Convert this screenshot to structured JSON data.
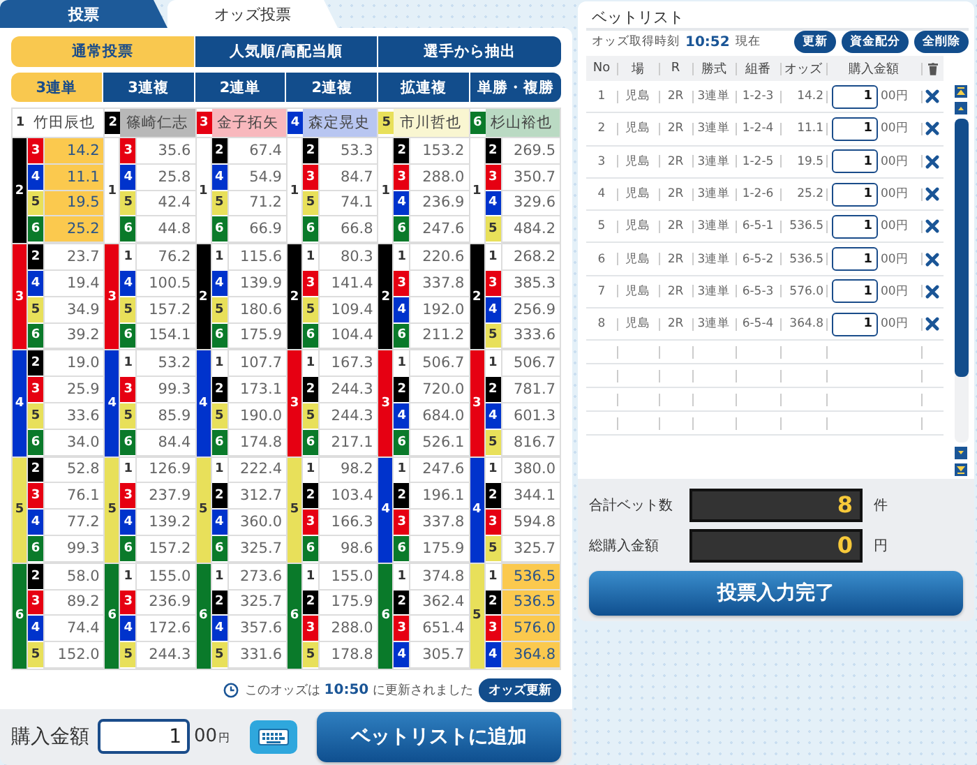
{
  "tabs": [
    {
      "label": "投票",
      "selected": false
    },
    {
      "label": "オッズ投票",
      "selected": true
    }
  ],
  "modes": [
    {
      "label": "通常投票",
      "selected": true
    },
    {
      "label": "人気順/高配当順",
      "selected": false
    },
    {
      "label": "選手から抽出",
      "selected": false
    }
  ],
  "bet_types": [
    {
      "label": "3連単",
      "selected": true
    },
    {
      "label": "3連複",
      "selected": false
    },
    {
      "label": "2連単",
      "selected": false
    },
    {
      "label": "2連複",
      "selected": false
    },
    {
      "label": "拡連複",
      "selected": false
    },
    {
      "label": "単勝・複勝",
      "selected": false
    }
  ],
  "racers": [
    {
      "number": "1",
      "name": "竹田辰也",
      "color": "#ffffff"
    },
    {
      "number": "2",
      "name": "篠崎仁志",
      "color": "#000000"
    },
    {
      "number": "3",
      "name": "金子拓矢",
      "color": "#e60012"
    },
    {
      "number": "4",
      "name": "森定晃史",
      "color": "#0033cc"
    },
    {
      "number": "5",
      "name": "市川哲也",
      "color": "#e8e05a"
    },
    {
      "number": "6",
      "name": "杉山裕也",
      "color": "#0a7a2a"
    }
  ],
  "odds_columns": [
    {
      "blocks": [
        {
          "boat": "2",
          "color": "#000000",
          "rows": [
            {
              "boat": "3",
              "color": "#e60012",
              "odds": "14.2",
              "selected": true
            },
            {
              "boat": "4",
              "color": "#0033cc",
              "odds": "11.1",
              "selected": true
            },
            {
              "boat": "5",
              "color": "#e8e05a",
              "odds": "19.5",
              "selected": true
            },
            {
              "boat": "6",
              "color": "#0a7a2a",
              "odds": "25.2",
              "selected": true
            }
          ]
        },
        {
          "boat": "3",
          "color": "#e60012",
          "rows": [
            {
              "boat": "2",
              "color": "#000000",
              "odds": "23.7",
              "selected": false
            },
            {
              "boat": "4",
              "color": "#0033cc",
              "odds": "19.4",
              "selected": false
            },
            {
              "boat": "5",
              "color": "#e8e05a",
              "odds": "34.9",
              "selected": false
            },
            {
              "boat": "6",
              "color": "#0a7a2a",
              "odds": "39.2",
              "selected": false
            }
          ]
        },
        {
          "boat": "4",
          "color": "#0033cc",
          "rows": [
            {
              "boat": "2",
              "color": "#000000",
              "odds": "19.0",
              "selected": false
            },
            {
              "boat": "3",
              "color": "#e60012",
              "odds": "25.9",
              "selected": false
            },
            {
              "boat": "5",
              "color": "#e8e05a",
              "odds": "33.6",
              "selected": false
            },
            {
              "boat": "6",
              "color": "#0a7a2a",
              "odds": "34.0",
              "selected": false
            }
          ]
        },
        {
          "boat": "5",
          "color": "#e8e05a",
          "rows": [
            {
              "boat": "2",
              "color": "#000000",
              "odds": "52.8",
              "selected": false
            },
            {
              "boat": "3",
              "color": "#e60012",
              "odds": "76.1",
              "selected": false
            },
            {
              "boat": "4",
              "color": "#0033cc",
              "odds": "77.2",
              "selected": false
            },
            {
              "boat": "6",
              "color": "#0a7a2a",
              "odds": "99.3",
              "selected": false
            }
          ]
        },
        {
          "boat": "6",
          "color": "#0a7a2a",
          "rows": [
            {
              "boat": "2",
              "color": "#000000",
              "odds": "58.0",
              "selected": false
            },
            {
              "boat": "3",
              "color": "#e60012",
              "odds": "89.2",
              "selected": false
            },
            {
              "boat": "4",
              "color": "#0033cc",
              "odds": "74.4",
              "selected": false
            },
            {
              "boat": "5",
              "color": "#e8e05a",
              "odds": "152.0",
              "selected": false
            }
          ]
        }
      ]
    },
    {
      "blocks": [
        {
          "boat": "1",
          "color": "#ffffff",
          "rows": [
            {
              "boat": "3",
              "color": "#e60012",
              "odds": "35.6",
              "selected": false
            },
            {
              "boat": "4",
              "color": "#0033cc",
              "odds": "25.8",
              "selected": false
            },
            {
              "boat": "5",
              "color": "#e8e05a",
              "odds": "42.4",
              "selected": false
            },
            {
              "boat": "6",
              "color": "#0a7a2a",
              "odds": "44.8",
              "selected": false
            }
          ]
        },
        {
          "boat": "3",
          "color": "#e60012",
          "rows": [
            {
              "boat": "1",
              "color": "#ffffff",
              "odds": "76.2",
              "selected": false
            },
            {
              "boat": "4",
              "color": "#0033cc",
              "odds": "100.5",
              "selected": false
            },
            {
              "boat": "5",
              "color": "#e8e05a",
              "odds": "157.2",
              "selected": false
            },
            {
              "boat": "6",
              "color": "#0a7a2a",
              "odds": "154.1",
              "selected": false
            }
          ]
        },
        {
          "boat": "4",
          "color": "#0033cc",
          "rows": [
            {
              "boat": "1",
              "color": "#ffffff",
              "odds": "53.2",
              "selected": false
            },
            {
              "boat": "3",
              "color": "#e60012",
              "odds": "99.3",
              "selected": false
            },
            {
              "boat": "5",
              "color": "#e8e05a",
              "odds": "85.9",
              "selected": false
            },
            {
              "boat": "6",
              "color": "#0a7a2a",
              "odds": "84.4",
              "selected": false
            }
          ]
        },
        {
          "boat": "5",
          "color": "#e8e05a",
          "rows": [
            {
              "boat": "1",
              "color": "#ffffff",
              "odds": "126.9",
              "selected": false
            },
            {
              "boat": "3",
              "color": "#e60012",
              "odds": "237.9",
              "selected": false
            },
            {
              "boat": "4",
              "color": "#0033cc",
              "odds": "139.2",
              "selected": false
            },
            {
              "boat": "6",
              "color": "#0a7a2a",
              "odds": "157.2",
              "selected": false
            }
          ]
        },
        {
          "boat": "6",
          "color": "#0a7a2a",
          "rows": [
            {
              "boat": "1",
              "color": "#ffffff",
              "odds": "155.0",
              "selected": false
            },
            {
              "boat": "3",
              "color": "#e60012",
              "odds": "236.9",
              "selected": false
            },
            {
              "boat": "4",
              "color": "#0033cc",
              "odds": "172.6",
              "selected": false
            },
            {
              "boat": "5",
              "color": "#e8e05a",
              "odds": "244.3",
              "selected": false
            }
          ]
        }
      ]
    },
    {
      "blocks": [
        {
          "boat": "1",
          "color": "#ffffff",
          "rows": [
            {
              "boat": "2",
              "color": "#000000",
              "odds": "67.4",
              "selected": false
            },
            {
              "boat": "4",
              "color": "#0033cc",
              "odds": "54.9",
              "selected": false
            },
            {
              "boat": "5",
              "color": "#e8e05a",
              "odds": "71.2",
              "selected": false
            },
            {
              "boat": "6",
              "color": "#0a7a2a",
              "odds": "66.9",
              "selected": false
            }
          ]
        },
        {
          "boat": "2",
          "color": "#000000",
          "rows": [
            {
              "boat": "1",
              "color": "#ffffff",
              "odds": "115.6",
              "selected": false
            },
            {
              "boat": "4",
              "color": "#0033cc",
              "odds": "139.9",
              "selected": false
            },
            {
              "boat": "5",
              "color": "#e8e05a",
              "odds": "180.6",
              "selected": false
            },
            {
              "boat": "6",
              "color": "#0a7a2a",
              "odds": "175.9",
              "selected": false
            }
          ]
        },
        {
          "boat": "4",
          "color": "#0033cc",
          "rows": [
            {
              "boat": "1",
              "color": "#ffffff",
              "odds": "107.7",
              "selected": false
            },
            {
              "boat": "2",
              "color": "#000000",
              "odds": "173.1",
              "selected": false
            },
            {
              "boat": "5",
              "color": "#e8e05a",
              "odds": "190.0",
              "selected": false
            },
            {
              "boat": "6",
              "color": "#0a7a2a",
              "odds": "174.8",
              "selected": false
            }
          ]
        },
        {
          "boat": "5",
          "color": "#e8e05a",
          "rows": [
            {
              "boat": "1",
              "color": "#ffffff",
              "odds": "222.4",
              "selected": false
            },
            {
              "boat": "2",
              "color": "#000000",
              "odds": "312.7",
              "selected": false
            },
            {
              "boat": "4",
              "color": "#0033cc",
              "odds": "360.0",
              "selected": false
            },
            {
              "boat": "6",
              "color": "#0a7a2a",
              "odds": "325.7",
              "selected": false
            }
          ]
        },
        {
          "boat": "6",
          "color": "#0a7a2a",
          "rows": [
            {
              "boat": "1",
              "color": "#ffffff",
              "odds": "273.6",
              "selected": false
            },
            {
              "boat": "2",
              "color": "#000000",
              "odds": "325.7",
              "selected": false
            },
            {
              "boat": "4",
              "color": "#0033cc",
              "odds": "357.6",
              "selected": false
            },
            {
              "boat": "5",
              "color": "#e8e05a",
              "odds": "331.6",
              "selected": false
            }
          ]
        }
      ]
    },
    {
      "blocks": [
        {
          "boat": "1",
          "color": "#ffffff",
          "rows": [
            {
              "boat": "2",
              "color": "#000000",
              "odds": "53.3",
              "selected": false
            },
            {
              "boat": "3",
              "color": "#e60012",
              "odds": "84.7",
              "selected": false
            },
            {
              "boat": "5",
              "color": "#e8e05a",
              "odds": "74.1",
              "selected": false
            },
            {
              "boat": "6",
              "color": "#0a7a2a",
              "odds": "66.8",
              "selected": false
            }
          ]
        },
        {
          "boat": "2",
          "color": "#000000",
          "rows": [
            {
              "boat": "1",
              "color": "#ffffff",
              "odds": "80.3",
              "selected": false
            },
            {
              "boat": "3",
              "color": "#e60012",
              "odds": "141.4",
              "selected": false
            },
            {
              "boat": "5",
              "color": "#e8e05a",
              "odds": "109.4",
              "selected": false
            },
            {
              "boat": "6",
              "color": "#0a7a2a",
              "odds": "104.4",
              "selected": false
            }
          ]
        },
        {
          "boat": "3",
          "color": "#e60012",
          "rows": [
            {
              "boat": "1",
              "color": "#ffffff",
              "odds": "167.3",
              "selected": false
            },
            {
              "boat": "2",
              "color": "#000000",
              "odds": "244.3",
              "selected": false
            },
            {
              "boat": "5",
              "color": "#e8e05a",
              "odds": "244.3",
              "selected": false
            },
            {
              "boat": "6",
              "color": "#0a7a2a",
              "odds": "217.1",
              "selected": false
            }
          ]
        },
        {
          "boat": "5",
          "color": "#e8e05a",
          "rows": [
            {
              "boat": "1",
              "color": "#ffffff",
              "odds": "98.2",
              "selected": false
            },
            {
              "boat": "2",
              "color": "#000000",
              "odds": "103.4",
              "selected": false
            },
            {
              "boat": "3",
              "color": "#e60012",
              "odds": "166.3",
              "selected": false
            },
            {
              "boat": "6",
              "color": "#0a7a2a",
              "odds": "98.6",
              "selected": false
            }
          ]
        },
        {
          "boat": "6",
          "color": "#0a7a2a",
          "rows": [
            {
              "boat": "1",
              "color": "#ffffff",
              "odds": "155.0",
              "selected": false
            },
            {
              "boat": "2",
              "color": "#000000",
              "odds": "175.9",
              "selected": false
            },
            {
              "boat": "3",
              "color": "#e60012",
              "odds": "288.0",
              "selected": false
            },
            {
              "boat": "5",
              "color": "#e8e05a",
              "odds": "178.8",
              "selected": false
            }
          ]
        }
      ]
    },
    {
      "blocks": [
        {
          "boat": "1",
          "color": "#ffffff",
          "rows": [
            {
              "boat": "2",
              "color": "#000000",
              "odds": "153.2",
              "selected": false
            },
            {
              "boat": "3",
              "color": "#e60012",
              "odds": "288.0",
              "selected": false
            },
            {
              "boat": "4",
              "color": "#0033cc",
              "odds": "236.9",
              "selected": false
            },
            {
              "boat": "6",
              "color": "#0a7a2a",
              "odds": "247.6",
              "selected": false
            }
          ]
        },
        {
          "boat": "2",
          "color": "#000000",
          "rows": [
            {
              "boat": "1",
              "color": "#ffffff",
              "odds": "220.6",
              "selected": false
            },
            {
              "boat": "3",
              "color": "#e60012",
              "odds": "337.8",
              "selected": false
            },
            {
              "boat": "4",
              "color": "#0033cc",
              "odds": "192.0",
              "selected": false
            },
            {
              "boat": "6",
              "color": "#0a7a2a",
              "odds": "211.2",
              "selected": false
            }
          ]
        },
        {
          "boat": "3",
          "color": "#e60012",
          "rows": [
            {
              "boat": "1",
              "color": "#ffffff",
              "odds": "506.7",
              "selected": false
            },
            {
              "boat": "2",
              "color": "#000000",
              "odds": "720.0",
              "selected": false
            },
            {
              "boat": "4",
              "color": "#0033cc",
              "odds": "684.0",
              "selected": false
            },
            {
              "boat": "6",
              "color": "#0a7a2a",
              "odds": "526.1",
              "selected": false
            }
          ]
        },
        {
          "boat": "4",
          "color": "#0033cc",
          "rows": [
            {
              "boat": "1",
              "color": "#ffffff",
              "odds": "247.6",
              "selected": false
            },
            {
              "boat": "2",
              "color": "#000000",
              "odds": "196.1",
              "selected": false
            },
            {
              "boat": "3",
              "color": "#e60012",
              "odds": "337.8",
              "selected": false
            },
            {
              "boat": "6",
              "color": "#0a7a2a",
              "odds": "175.9",
              "selected": false
            }
          ]
        },
        {
          "boat": "6",
          "color": "#0a7a2a",
          "rows": [
            {
              "boat": "1",
              "color": "#ffffff",
              "odds": "374.8",
              "selected": false
            },
            {
              "boat": "2",
              "color": "#000000",
              "odds": "362.4",
              "selected": false
            },
            {
              "boat": "3",
              "color": "#e60012",
              "odds": "651.4",
              "selected": false
            },
            {
              "boat": "4",
              "color": "#0033cc",
              "odds": "305.7",
              "selected": false
            }
          ]
        }
      ]
    },
    {
      "blocks": [
        {
          "boat": "1",
          "color": "#ffffff",
          "rows": [
            {
              "boat": "2",
              "color": "#000000",
              "odds": "269.5",
              "selected": false
            },
            {
              "boat": "3",
              "color": "#e60012",
              "odds": "350.7",
              "selected": false
            },
            {
              "boat": "4",
              "color": "#0033cc",
              "odds": "329.6",
              "selected": false
            },
            {
              "boat": "5",
              "color": "#e8e05a",
              "odds": "484.2",
              "selected": false
            }
          ]
        },
        {
          "boat": "2",
          "color": "#000000",
          "rows": [
            {
              "boat": "1",
              "color": "#ffffff",
              "odds": "268.2",
              "selected": false
            },
            {
              "boat": "3",
              "color": "#e60012",
              "odds": "385.3",
              "selected": false
            },
            {
              "boat": "4",
              "color": "#0033cc",
              "odds": "256.9",
              "selected": false
            },
            {
              "boat": "5",
              "color": "#e8e05a",
              "odds": "333.6",
              "selected": false
            }
          ]
        },
        {
          "boat": "3",
          "color": "#e60012",
          "rows": [
            {
              "boat": "1",
              "color": "#ffffff",
              "odds": "506.7",
              "selected": false
            },
            {
              "boat": "2",
              "color": "#000000",
              "odds": "781.7",
              "selected": false
            },
            {
              "boat": "4",
              "color": "#0033cc",
              "odds": "601.3",
              "selected": false
            },
            {
              "boat": "5",
              "color": "#e8e05a",
              "odds": "816.7",
              "selected": false
            }
          ]
        },
        {
          "boat": "4",
          "color": "#0033cc",
          "rows": [
            {
              "boat": "1",
              "color": "#ffffff",
              "odds": "380.0",
              "selected": false
            },
            {
              "boat": "2",
              "color": "#000000",
              "odds": "344.1",
              "selected": false
            },
            {
              "boat": "3",
              "color": "#e60012",
              "odds": "594.8",
              "selected": false
            },
            {
              "boat": "5",
              "color": "#e8e05a",
              "odds": "325.7",
              "selected": false
            }
          ]
        },
        {
          "boat": "5",
          "color": "#e8e05a",
          "rows": [
            {
              "boat": "1",
              "color": "#ffffff",
              "odds": "536.5",
              "selected": true
            },
            {
              "boat": "2",
              "color": "#000000",
              "odds": "536.5",
              "selected": true
            },
            {
              "boat": "3",
              "color": "#e60012",
              "odds": "576.0",
              "selected": true
            },
            {
              "boat": "4",
              "color": "#0033cc",
              "odds": "364.8",
              "selected": true
            }
          ]
        }
      ]
    }
  ],
  "update_note": {
    "prefix": "このオッズは",
    "time": "10:50",
    "suffix": "に更新されました",
    "button": "オッズ更新"
  },
  "purchase": {
    "label": "購入金額",
    "value": "1",
    "unit": "00",
    "currency": "円",
    "button": "ベットリストに追加"
  },
  "bet_list": {
    "title": "ベットリスト",
    "time_label": "オッズ取得時刻",
    "time": "10:52",
    "time_suffix": "現在",
    "buttons": [
      "更新",
      "資金配分",
      "全削除"
    ],
    "columns": [
      "No",
      "場",
      "R",
      "勝式",
      "組番",
      "オッズ",
      "購入金額"
    ],
    "rows": [
      {
        "no": "1",
        "venue": "児島",
        "race": "2R",
        "type": "3連単",
        "combo": "1-2-3",
        "odds": "14.2",
        "amount": "1",
        "unit": "00円"
      },
      {
        "no": "2",
        "venue": "児島",
        "race": "2R",
        "type": "3連単",
        "combo": "1-2-4",
        "odds": "11.1",
        "amount": "1",
        "unit": "00円"
      },
      {
        "no": "3",
        "venue": "児島",
        "race": "2R",
        "type": "3連単",
        "combo": "1-2-5",
        "odds": "19.5",
        "amount": "1",
        "unit": "00円"
      },
      {
        "no": "4",
        "venue": "児島",
        "race": "2R",
        "type": "3連単",
        "combo": "1-2-6",
        "odds": "25.2",
        "amount": "1",
        "unit": "00円"
      },
      {
        "no": "5",
        "venue": "児島",
        "race": "2R",
        "type": "3連単",
        "combo": "6-5-1",
        "odds": "536.5",
        "amount": "1",
        "unit": "00円"
      },
      {
        "no": "6",
        "venue": "児島",
        "race": "2R",
        "type": "3連単",
        "combo": "6-5-2",
        "odds": "536.5",
        "amount": "1",
        "unit": "00円"
      },
      {
        "no": "7",
        "venue": "児島",
        "race": "2R",
        "type": "3連単",
        "combo": "6-5-3",
        "odds": "576.0",
        "amount": "1",
        "unit": "00円"
      },
      {
        "no": "8",
        "venue": "児島",
        "race": "2R",
        "type": "3連単",
        "combo": "6-5-4",
        "odds": "364.8",
        "amount": "1",
        "unit": "00円"
      }
    ]
  },
  "summary": {
    "count_label": "合計ベット数",
    "count": "8",
    "count_unit": "件",
    "total_label": "総購入金額",
    "total": "0",
    "total_unit": "円",
    "button": "投票入力完了"
  }
}
